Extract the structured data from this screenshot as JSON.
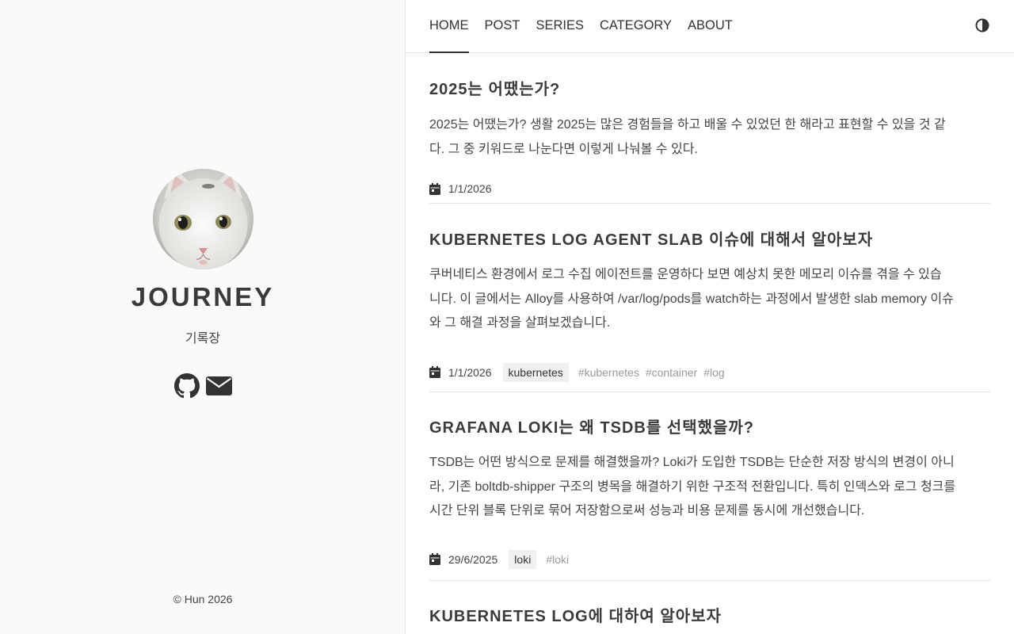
{
  "sidebar": {
    "title": "JOURNEY",
    "subtitle": "기록장",
    "social_icons": [
      "github-icon",
      "mail-icon"
    ],
    "copyright": "© Hun 2026"
  },
  "nav": {
    "items": [
      {
        "label": "HOME",
        "active": true
      },
      {
        "label": "POST"
      },
      {
        "label": "SERIES"
      },
      {
        "label": "CATEGORY"
      },
      {
        "label": "ABOUT"
      }
    ],
    "theme_icon": "contrast-icon"
  },
  "posts": [
    {
      "title": "2025는 어땠는가?",
      "summary_lines": [
        "2025는 어땠는가? 생활 2025는 많은 경험들을 하고 배울 수 있었던 한 해라고 표현할 수 있을 것 같",
        "다. 그 중 키워드로 나눈다면 이렇게 나눠볼 수 있다."
      ],
      "date": "1/1/2026"
    },
    {
      "title": "KUBERNETES LOG AGENT SLAB 이슈에 대해서 알아보자",
      "summary_lines": [
        "쿠버네티스 환경에서 로그 수집 에이전트를 운영하다 보면 예상치 못한 메모리 이슈를 겪을 수 있습",
        "니다. 이 글에서는 Alloy를 사용하여 /var/log/pods를 watch하는 과정에서 발생한 slab memory 이슈",
        "와 그 해결 과정을 살펴보겠습니다."
      ],
      "date": "1/1/2026",
      "category": "kubernetes",
      "tags": [
        "#kubernetes",
        "#container",
        "#log"
      ]
    },
    {
      "title": "GRAFANA LOKI는 왜 TSDB를 선택했을까?",
      "summary_lines": [
        "TSDB는 어떤 방식으로 문제를 해결했을까? Loki가 도입한 TSDB는 단순한 저장 방식의 변경이 아니",
        "라, 기존 boltdb-shipper 구조의 병목을 해결하기 위한 구조적 전환입니다. 특히 인덱스와 로그 청크를",
        "시간 단위 블록 단위로 묶어 저장함으로써 성능과 비용 문제를 동시에 개선했습니다."
      ],
      "date": "29/6/2025",
      "category": "loki",
      "tags": [
        "#loki"
      ]
    },
    {
      "title": "KUBERNETES LOG에 대하여 알아보자"
    }
  ],
  "colors": {
    "sidebar_bg": "#fafafa",
    "text": "#333333",
    "tag_text": "#9a9a9a",
    "badge_bg": "#f0f0f0",
    "divider": "#e5e5e5"
  }
}
